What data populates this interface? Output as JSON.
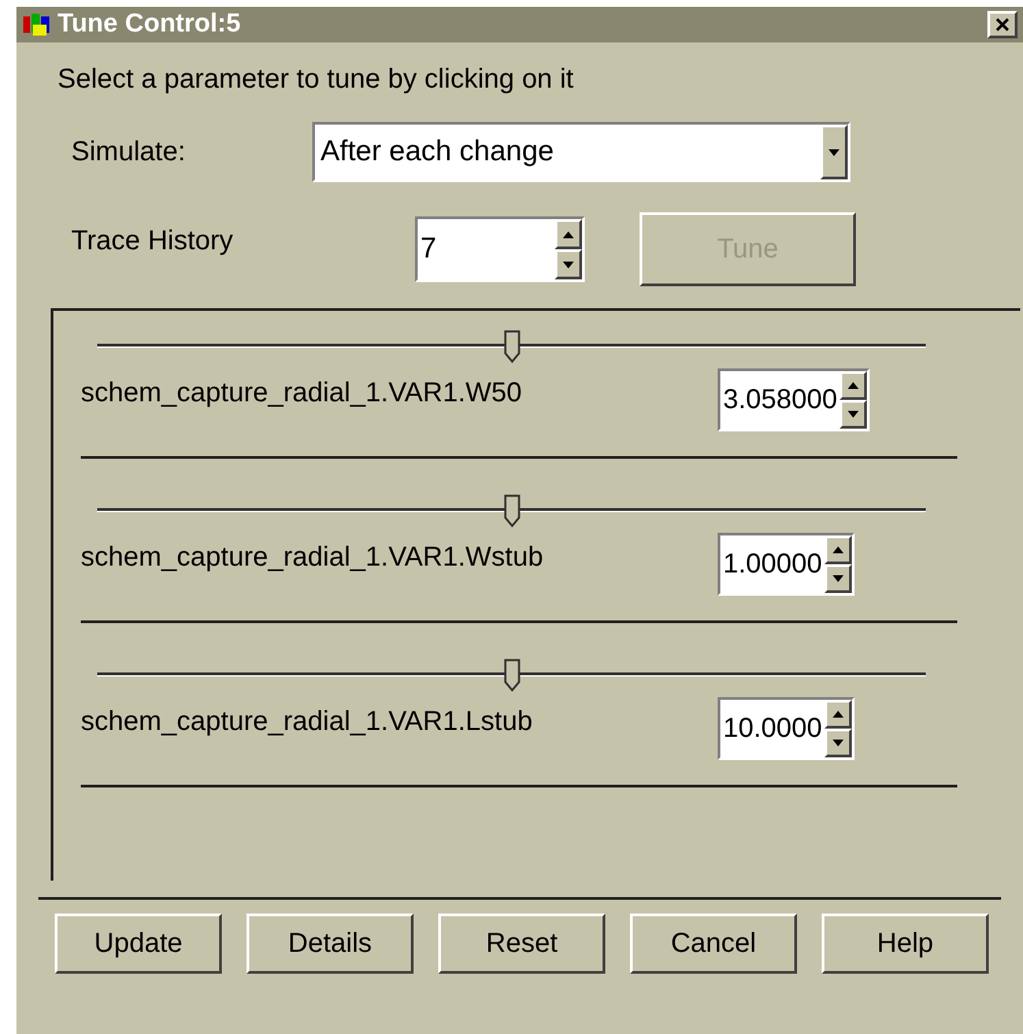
{
  "window": {
    "title": "Tune Control:5"
  },
  "instruction": "Select a parameter to tune by clicking on it",
  "simulate": {
    "label": "Simulate:",
    "value": "After each change"
  },
  "trace_history": {
    "label": "Trace History",
    "value": "7"
  },
  "tune_button": {
    "label": "Tune",
    "disabled": true
  },
  "parameters": [
    {
      "name": "schem_capture_radial_1.VAR1.W50",
      "value": "3.058000",
      "level": 0.5
    },
    {
      "name": "schem_capture_radial_1.VAR1.Wstub",
      "value": "1.00000",
      "level": 0.5
    },
    {
      "name": "schem_capture_radial_1.VAR1.Lstub",
      "value": "10.0000",
      "level": 0.5
    }
  ],
  "buttons": [
    "Update",
    "Details",
    "Reset",
    "Cancel",
    "Help"
  ]
}
